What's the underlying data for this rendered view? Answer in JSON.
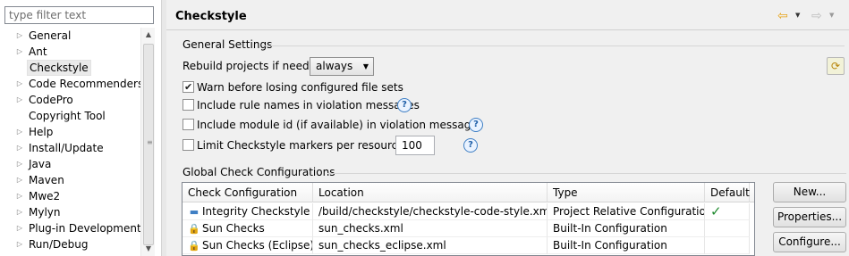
{
  "sidebar": {
    "filter_placeholder": "type filter text",
    "items": [
      {
        "label": "General",
        "expandable": true
      },
      {
        "label": "Ant",
        "expandable": true
      },
      {
        "label": "Checkstyle",
        "expandable": false,
        "selected": true
      },
      {
        "label": "Code Recommenders",
        "expandable": true
      },
      {
        "label": "CodePro",
        "expandable": true
      },
      {
        "label": "Copyright Tool",
        "expandable": false
      },
      {
        "label": "Help",
        "expandable": true
      },
      {
        "label": "Install/Update",
        "expandable": true
      },
      {
        "label": "Java",
        "expandable": true
      },
      {
        "label": "Maven",
        "expandable": true
      },
      {
        "label": "Mwe2",
        "expandable": true
      },
      {
        "label": "Mylyn",
        "expandable": true
      },
      {
        "label": "Plug-in Development",
        "expandable": true
      },
      {
        "label": "Run/Debug",
        "expandable": true
      }
    ]
  },
  "header": {
    "title": "Checkstyle"
  },
  "general_settings": {
    "label": "General Settings",
    "rebuild_label": "Rebuild projects if needed:",
    "rebuild_value": "always",
    "warn_label": "Warn before losing configured file sets",
    "warn_checked": true,
    "rule_names_label": "Include rule names in violation messages",
    "rule_names_checked": false,
    "module_id_label": "Include module id (if available) in violation messages",
    "module_id_checked": false,
    "limit_label": "Limit Checkstyle markers per resource to",
    "limit_checked": false,
    "limit_value": "100"
  },
  "global_configs": {
    "label": "Global Check Configurations",
    "columns": [
      "Check Configuration",
      "Location",
      "Type",
      "Default"
    ],
    "rows": [
      {
        "icon": "folder-icon",
        "name": "Integrity Checkstyle",
        "location": "/build/checkstyle/checkstyle-code-style.xml",
        "type": "Project Relative Configuration",
        "default": true
      },
      {
        "icon": "lock-icon",
        "name": "Sun Checks",
        "location": "sun_checks.xml",
        "type": "Built-In Configuration",
        "default": false
      },
      {
        "icon": "lock-icon",
        "name": "Sun Checks (Eclipse)",
        "location": "sun_checks_eclipse.xml",
        "type": "Built-In Configuration",
        "default": false
      }
    ],
    "buttons": {
      "new": "New...",
      "properties": "Properties...",
      "configure": "Configure..."
    }
  },
  "colors": {
    "accent": "#3f7fc4",
    "default_check": "#1f8a2e",
    "nav_back": "#e8a317"
  }
}
